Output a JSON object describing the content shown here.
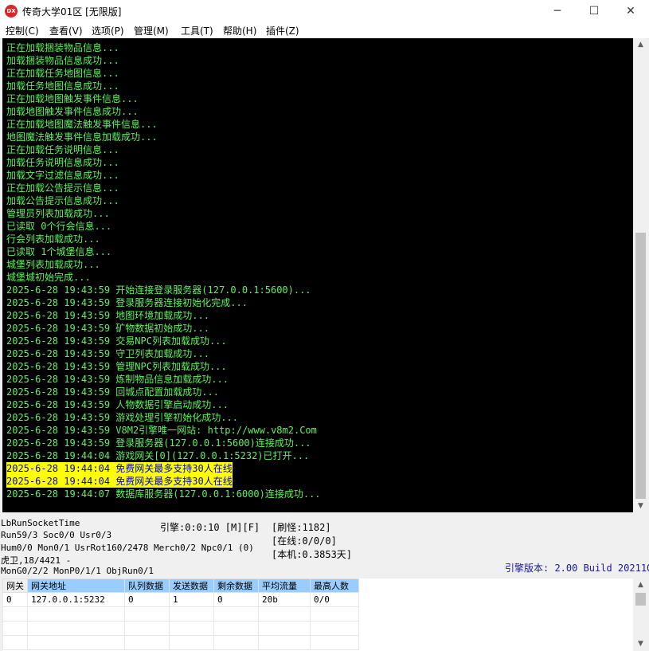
{
  "window": {
    "title": "传奇大学01区 [无限版]",
    "icon_text": "DX",
    "minimize_icon": "─",
    "maximize_icon": "☐",
    "close_icon": "✕"
  },
  "menu": [
    "控制(C)",
    "查看(V)",
    "选项(P)",
    "管理(M)",
    "工具(T)",
    "帮助(H)",
    "插件(Z)"
  ],
  "console": {
    "lines": [
      {
        "text": "正在加载捆装物品信息...",
        "highlight": false
      },
      {
        "text": "加载捆装物品信息成功...",
        "highlight": false
      },
      {
        "text": "正在加载任务地图信息...",
        "highlight": false
      },
      {
        "text": "加载任务地图信息成功...",
        "highlight": false
      },
      {
        "text": "正在加载地图触发事件信息...",
        "highlight": false
      },
      {
        "text": "加载地图触发事件信息成功...",
        "highlight": false
      },
      {
        "text": "正在加载地图魔法触发事件信息...",
        "highlight": false
      },
      {
        "text": "地图魔法触发事件信息加载成功...",
        "highlight": false
      },
      {
        "text": "正在加载任务说明信息...",
        "highlight": false
      },
      {
        "text": "加载任务说明信息成功...",
        "highlight": false
      },
      {
        "text": "加载文字过滤信息成功...",
        "highlight": false
      },
      {
        "text": "正在加载公告提示信息...",
        "highlight": false
      },
      {
        "text": "加载公告提示信息成功...",
        "highlight": false
      },
      {
        "text": "管理员列表加载成功...",
        "highlight": false
      },
      {
        "text": "已读取 0个行会信息...",
        "highlight": false
      },
      {
        "text": "行会列表加载成功...",
        "highlight": false
      },
      {
        "text": "已读取 1个城堡信息...",
        "highlight": false
      },
      {
        "text": "城堡列表加载成功...",
        "highlight": false
      },
      {
        "text": "城堡城初始完成...",
        "highlight": false
      },
      {
        "text": "2025-6-28 19:43:59 开始连接登录服务器(127.0.0.1:5600)...",
        "highlight": false
      },
      {
        "text": "2025-6-28 19:43:59 登录服务器连接初始化完成...",
        "highlight": false
      },
      {
        "text": "2025-6-28 19:43:59 地图环境加载成功...",
        "highlight": false
      },
      {
        "text": "2025-6-28 19:43:59 矿物数据初始成功...",
        "highlight": false
      },
      {
        "text": "2025-6-28 19:43:59 交易NPC列表加载成功...",
        "highlight": false
      },
      {
        "text": "2025-6-28 19:43:59 守卫列表加载成功...",
        "highlight": false
      },
      {
        "text": "2025-6-28 19:43:59 管理NPC列表加载成功...",
        "highlight": false
      },
      {
        "text": "2025-6-28 19:43:59 炼制物品信息加载成功...",
        "highlight": false
      },
      {
        "text": "2025-6-28 19:43:59 回城点配置加载成功...",
        "highlight": false
      },
      {
        "text": "2025-6-28 19:43:59 人物数据引擎启动成功...",
        "highlight": false
      },
      {
        "text": "2025-6-28 19:43:59 游戏处理引擎初始化成功...",
        "highlight": false
      },
      {
        "text": "2025-6-28 19:43:59 V8M2引擎唯一网站: http://www.v8m2.Com",
        "highlight": false
      },
      {
        "text": "2025-6-28 19:43:59 登录服务器(127.0.0.1:5600)连接成功...",
        "highlight": false
      },
      {
        "text": "2025-6-28 19:44:04 游戏网关[0](127.0.0.1:5232)已打开...",
        "highlight": false
      },
      {
        "text": "2025-6-28 19:44:04 免费网关最多支持30人在线",
        "highlight": true
      },
      {
        "text": "2025-6-28 19:44:04 免费网关最多支持30人在线",
        "highlight": true
      },
      {
        "text": "2025-6-28 19:44:07 数据库服务器(127.0.0.1:6000)连接成功...",
        "highlight": false
      }
    ]
  },
  "status": {
    "run_socket_time": "LbRunSocketTime",
    "run_counts": "Run59/3 Soc0/0 Usr0/3",
    "engine_timer": "引擎:0:0:10 [M][F]",
    "refresh": "[刷怪:1182]",
    "online": "[在线:0/0/0]",
    "local": "[本机:0.3853天]",
    "hum_mon": "Hum0/0 Mon0/1 UsrRot160/2478 Merch0/2 Npc0/1 (0)",
    "guard": "虎卫,18/4421 -",
    "mon_gen": "MonG0/2/2 MonP0/1/1 ObjRun0/1",
    "engine_version": "引擎版本: 2.00 Build 20211009"
  },
  "gateway_table": {
    "headers": [
      "网关",
      "网关地址",
      "队列数据",
      "发送数据",
      "剩余数据",
      "平均流量",
      "最高人数"
    ],
    "rows": [
      [
        "0",
        "127.0.0.1:5232",
        "0",
        "1",
        "0",
        "20b",
        "0/0"
      ]
    ]
  }
}
